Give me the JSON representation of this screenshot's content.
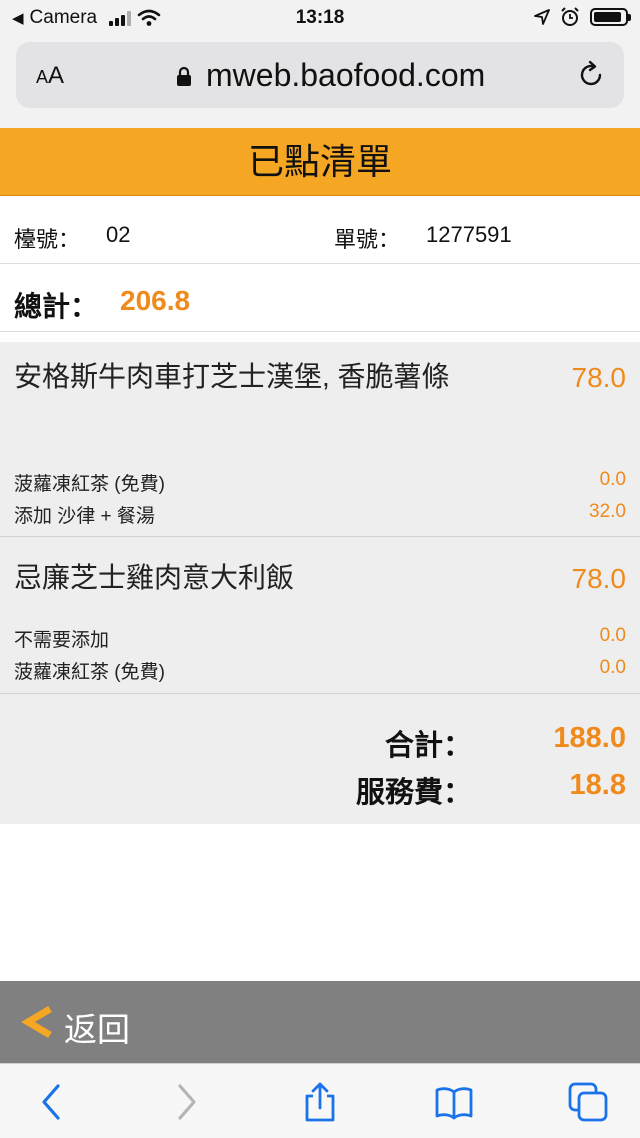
{
  "status_bar": {
    "back_app": "Camera",
    "time": "13:18",
    "battery_level": 0.9
  },
  "browser": {
    "text_size_label_small": "A",
    "text_size_label_large": "A",
    "url": "mweb.baofood.com",
    "icons": [
      "lock-icon",
      "reload-icon",
      "back-icon",
      "forward-icon",
      "share-icon",
      "bookmarks-icon",
      "tabs-icon"
    ]
  },
  "page": {
    "title": "已點清單",
    "table_label": "檯號：",
    "table_number": "02",
    "order_label": "單號：",
    "order_number": "1277591",
    "grand_total_label": "總計：",
    "grand_total_value": "206.8"
  },
  "order_items": [
    {
      "name": "安格斯牛肉車打芝士漢堡, 香脆薯條",
      "price": "78.0",
      "options": [
        {
          "name": "菠蘿凍紅茶 (免費)",
          "price": "0.0"
        },
        {
          "name": "添加 沙律 + 餐湯",
          "price": "32.0"
        }
      ]
    },
    {
      "name": "忌廉芝士雞肉意大利飯",
      "price": "78.0",
      "options": [
        {
          "name": "不需要添加",
          "price": "0.0"
        },
        {
          "name": "菠蘿凍紅茶 (免費)",
          "price": "0.0"
        }
      ]
    }
  ],
  "summary": {
    "subtotal_label": "合計：",
    "subtotal_value": "188.0",
    "service_label": "服務費：",
    "service_value": "18.8"
  },
  "footer": {
    "back_label": "返回"
  },
  "colors": {
    "header_bg": "#f5a623",
    "accent": "#f08a1c",
    "back_bar_bg": "#808080",
    "ios_blue": "#1a73e8"
  }
}
